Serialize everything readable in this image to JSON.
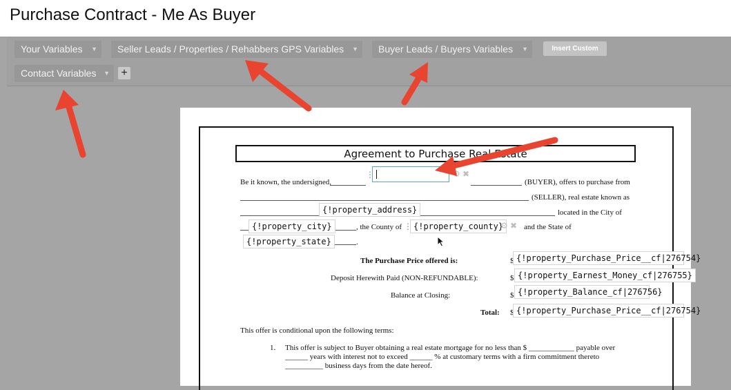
{
  "page": {
    "title": "Purchase Contract - Me As Buyer"
  },
  "toolbar": {
    "your_variables": "Your Variables",
    "seller_variables": "Seller Leads / Properties / Rehabbers GPS Variables",
    "buyer_variables": "Buyer Leads / Buyers Variables",
    "insert_custom": "Insert Custom",
    "contact_variables": "Contact Variables",
    "add": "+",
    "caret": "▼"
  },
  "document": {
    "heading": "Agreement to Purchase Real Estate",
    "line1_prefix": "Be it known, the undersigned,",
    "line1_suffix": "(BUYER), offers to purchase from",
    "line2_suffix": "(SELLER), real estate known as",
    "property_address": "{!property_address}",
    "line3_suffix": "located in the City of",
    "property_city": "{!property_city}",
    "county_label": ", the County of",
    "property_county": "{!property_county}",
    "state_label": "and the State of",
    "property_state": "{!property_state}",
    "period": ".",
    "price_label": "The Purchase Price offered is:",
    "deposit_label": "Deposit Herewith Paid (NON-REFUNDABLE):",
    "balance_label": "Balance at Closing:",
    "total_label": "Total:",
    "currency": "$",
    "purchase_price": "{!property_Purchase_Price__cf|276754}",
    "earnest_money": "{!property_Earnest_Money_cf|276755}",
    "balance": "{!property_Balance_cf|276756}",
    "total": "{!property_Purchase_Price__cf|276754}",
    "conditions_intro": "This offer is conditional upon the following terms:",
    "term1_number": "1.",
    "term1_line1": "This offer is subject to Buyer obtaining a real estate mortgage for no less than $ ____________ payable over",
    "term1_line2": "______ years with interest not to exceed ______ % at customary terms with a firm commitment thereto",
    "term1_line3": "__________ business days from the date hereof."
  },
  "icons": {
    "gear": "gear-icon",
    "close": "close-icon",
    "drag": "drag-handle-icon",
    "cursor": "mouse-cursor-icon"
  },
  "colors": {
    "arrow": "#e8442f",
    "toolbar": "#a1a1a1",
    "background": "#a5a5a5",
    "focus": "#5aa6c9"
  }
}
